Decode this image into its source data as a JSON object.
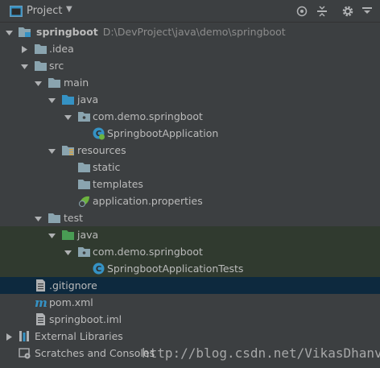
{
  "header": {
    "title": "Project",
    "dropdown_glyph": "▼"
  },
  "tree": {
    "root_name": "springboot",
    "root_path": "D:\\DevProject\\java\\demo\\springboot",
    "idea": ".idea",
    "src": "src",
    "main": "main",
    "main_java": "java",
    "main_package": "com.demo.springboot",
    "app_class": "SpringbootApplication",
    "resources": "resources",
    "static": "static",
    "templates": "templates",
    "app_props": "application.properties",
    "test": "test",
    "test_java": "java",
    "test_package": "com.demo.springboot",
    "test_class": "SpringbootApplicationTests",
    "gitignore": ".gitignore",
    "pom": "pom.xml",
    "iml": "springboot.iml",
    "ext_libs": "External Libraries",
    "scratches": "Scratches and Consoles"
  },
  "watermark": "http://blog.csdn.net/VikasDhanve",
  "colors": {
    "panel_bg": "#3c3f41",
    "selected_row": "#0d293e",
    "test_row_bg": "#303a2f",
    "folder": "#8aa4af",
    "source_folder": "#3592c4",
    "test_folder": "#499c54"
  }
}
